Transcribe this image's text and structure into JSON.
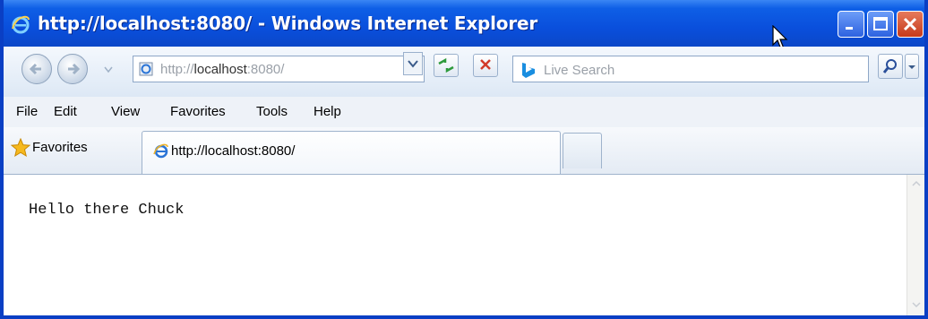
{
  "window": {
    "title": "http://localhost:8080/ - Windows Internet Explorer"
  },
  "address_bar": {
    "url_prefix": "http://",
    "url_host": "localhost",
    "url_suffix": ":8080/"
  },
  "search": {
    "placeholder": "Live Search"
  },
  "menu": {
    "items": [
      "File",
      "Edit",
      "View",
      "Favorites",
      "Tools",
      "Help"
    ]
  },
  "favorites_bar": {
    "favorites_label": "Favorites"
  },
  "tabs": [
    {
      "label": "http://localhost:8080/"
    }
  ],
  "content": {
    "body_text": "Hello there Chuck"
  },
  "colors": {
    "title_bar": "#0a4fdc",
    "title_text": "#ffffff",
    "close_button": "#c63a1a"
  },
  "icons": {
    "title": "ie-logo-icon",
    "back": "back-arrow-icon",
    "forward": "forward-arrow-icon",
    "refresh": "refresh-icon",
    "stop": "stop-x-icon",
    "search_provider": "bing-logo-icon",
    "search_go": "magnifier-icon",
    "favorites": "star-icon"
  }
}
